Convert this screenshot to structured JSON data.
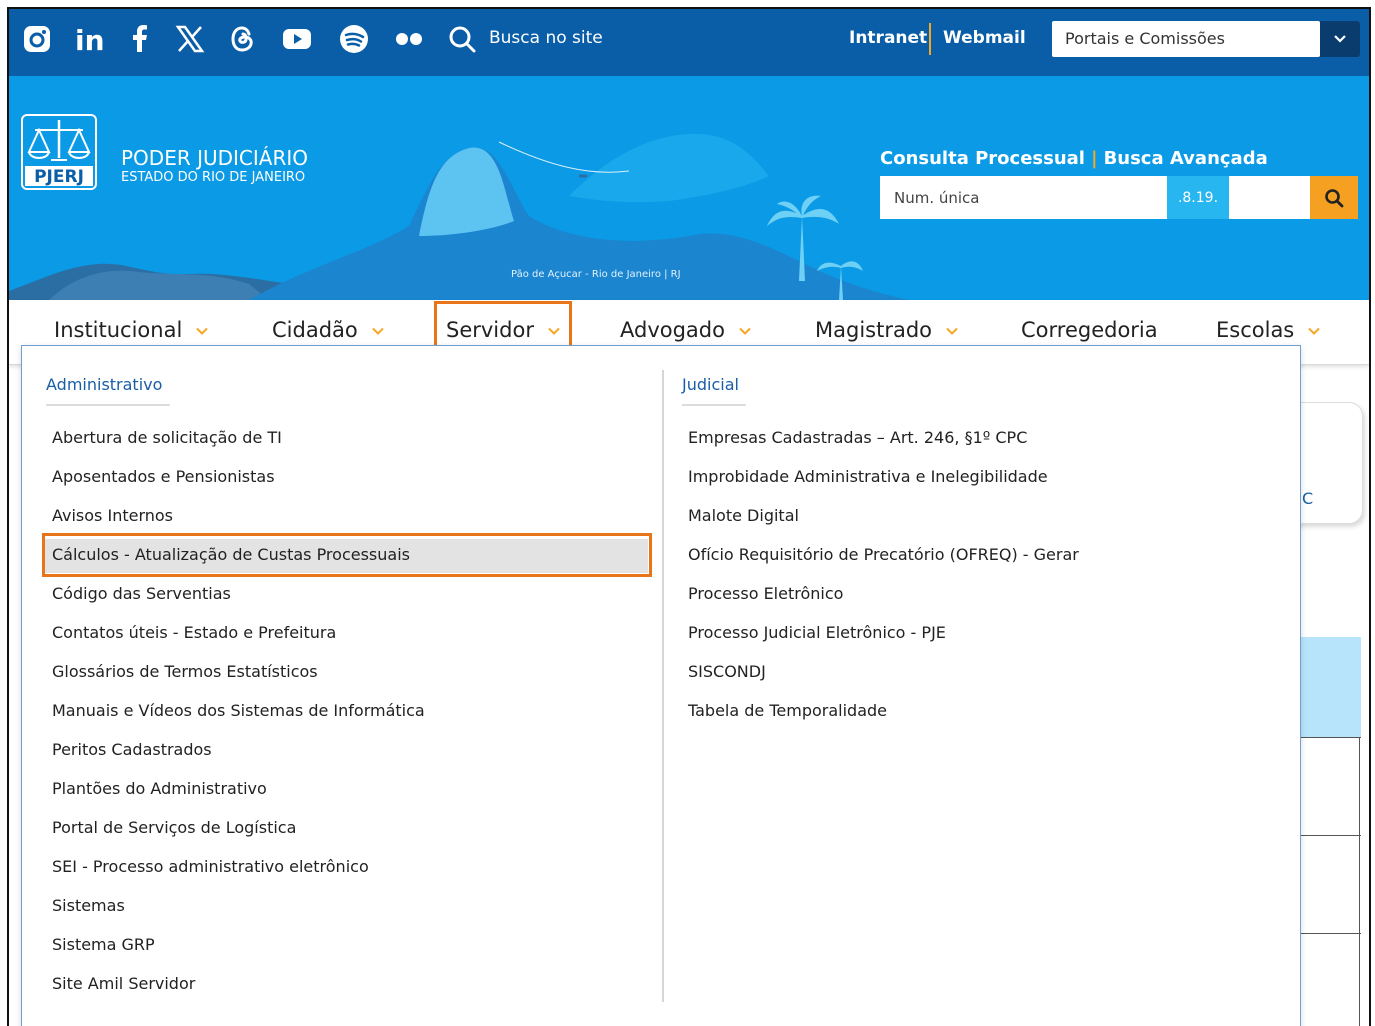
{
  "topbar": {
    "social_icons": [
      "instagram-icon",
      "linkedin-icon",
      "facebook-icon",
      "x-icon",
      "threads-icon",
      "youtube-icon",
      "spotify-icon",
      "flickr-icon"
    ],
    "search_label": "Busca no site",
    "intranet": "Intranet",
    "webmail": "Webmail",
    "portais": "Portais e Comissões"
  },
  "banner": {
    "logo_text": "PJERJ",
    "org_title": "PODER JUDICIÁRIO",
    "org_subtitle": "ESTADO DO RIO DE JANEIRO",
    "caption": "Pão de Açucar - Rio de Janeiro | RJ",
    "consulta": "Consulta Processual",
    "busca": "Busca Avançada",
    "num_placeholder": "Num. única",
    "num_mid": ".8.19."
  },
  "nav": {
    "items": [
      "Institucional",
      "Cidadão",
      "Servidor",
      "Advogado",
      "Magistrado",
      "Corregedoria",
      "Escolas"
    ],
    "active": "Servidor"
  },
  "dropdown": {
    "administrativo": {
      "title": "Administrativo",
      "links": [
        "Abertura de solicitação de TI",
        "Aposentados e Pensionistas",
        "Avisos Internos",
        "Cálculos - Atualização de Custas Processuais",
        "Código das Serventias",
        "Contatos úteis - Estado e Prefeitura",
        "Glossários de Termos Estatísticos",
        "Manuais e Vídeos dos Sistemas de Informática",
        "Peritos Cadastrados",
        "Plantões do Administrativo",
        "Portal de Serviços de Logística",
        "SEI - Processo administrativo eletrônico",
        "Sistemas",
        "Sistema GRP",
        "Site Amil Servidor"
      ]
    },
    "judicial": {
      "title": "Judicial",
      "links": [
        "Empresas Cadastradas – Art. 246, §1º CPC",
        "Improbidade Administrativa e Inelegibilidade",
        "Malote Digital",
        "Ofício Requisitório de Precatório (OFREQ) - Gerar",
        "Processo Eletrônico",
        "Processo Judicial Eletrônico - PJE",
        "SISCONDJ",
        "Tabela de Temporalidade"
      ]
    }
  },
  "background": {
    "partial_letter": "C"
  },
  "colors": {
    "topbar": "#0a5ea8",
    "banner": "#0a9ae6",
    "accent_orange": "#e8751a",
    "link_blue": "#1a5ea8"
  }
}
